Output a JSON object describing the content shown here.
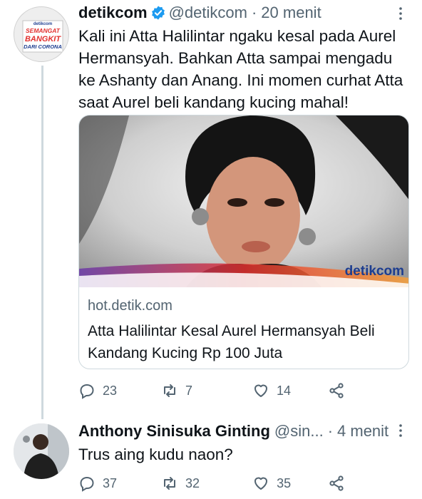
{
  "tweet1": {
    "avatar_text": [
      "detikcom",
      "SEMANGAT",
      "BANGKIT",
      "DARI CORONA"
    ],
    "name": "detikcom",
    "handle": "@detikcom",
    "separator": "·",
    "time": "20 menit",
    "text": "Kali ini Atta Halilintar ngaku kesal pada Aurel Hermansyah. Bahkan Atta sampai mengadu ke Ashanty dan Anang. Ini momen curhat Atta saat Aurel beli kandang kucing mahal!",
    "card": {
      "image_logo": "detikcom",
      "domain": "hot.detik.com",
      "title": "Atta Halilintar Kesal Aurel Hermansyah Beli Kandang Kucing Rp 100 Juta"
    },
    "replies": "23",
    "retweets": "7",
    "likes": "14"
  },
  "tweet2": {
    "name": "Anthony Sinisuka Ginting",
    "handle": "@sin...",
    "separator": "·",
    "time": "4 menit",
    "text": "Trus aing kudu naon?",
    "replies": "37",
    "retweets": "32",
    "likes": "35"
  },
  "colors": {
    "verified": "#1d9bf0",
    "secondary_text": "#536471",
    "avatar_bg": "#e6e6e6",
    "logo_red": "#e2312f",
    "logo_blue": "#1d3d8f"
  }
}
